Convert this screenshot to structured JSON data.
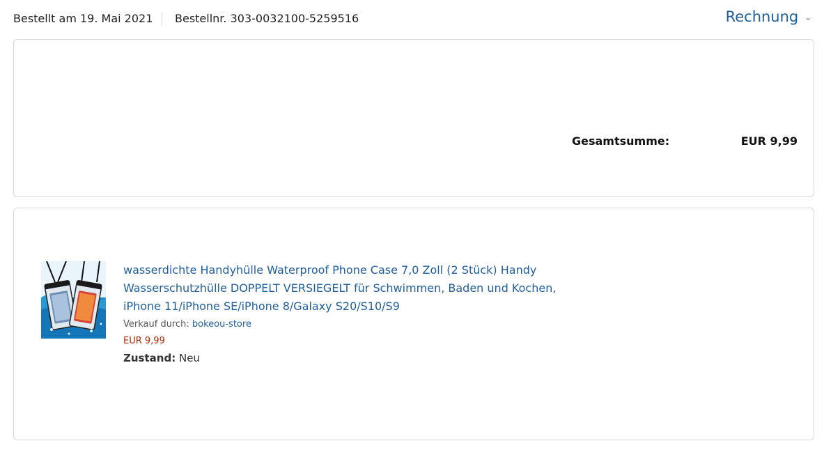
{
  "header": {
    "order_date": "Bestellt am 19. Mai 2021",
    "order_number": "Bestellnr. 303-0032100-5259516",
    "invoice_label": "Rechnung",
    "invoice_chevron_icon": "chevron-down-icon"
  },
  "summary": {
    "total_label": "Gesamtsumme:",
    "total_value": "EUR 9,99"
  },
  "item": {
    "title": "wasserdichte Handyhülle Waterproof Phone Case 7,0 Zoll (2 Stück) Handy Wasserschutzhülle DOPPELT VERSIEGELT für Schwimmen, Baden und Kochen, iPhone 11/iPhone SE/iPhone 8/Galaxy S20/S10/S9",
    "sold_by_label": "Verkauf durch:",
    "seller": "bokeou-store",
    "price": "EUR 9,99",
    "condition_label": "Zustand:",
    "condition_value": "Neu"
  },
  "colors": {
    "link": "#1f5e9c",
    "price": "#b12704",
    "border": "#d5d9d9"
  }
}
